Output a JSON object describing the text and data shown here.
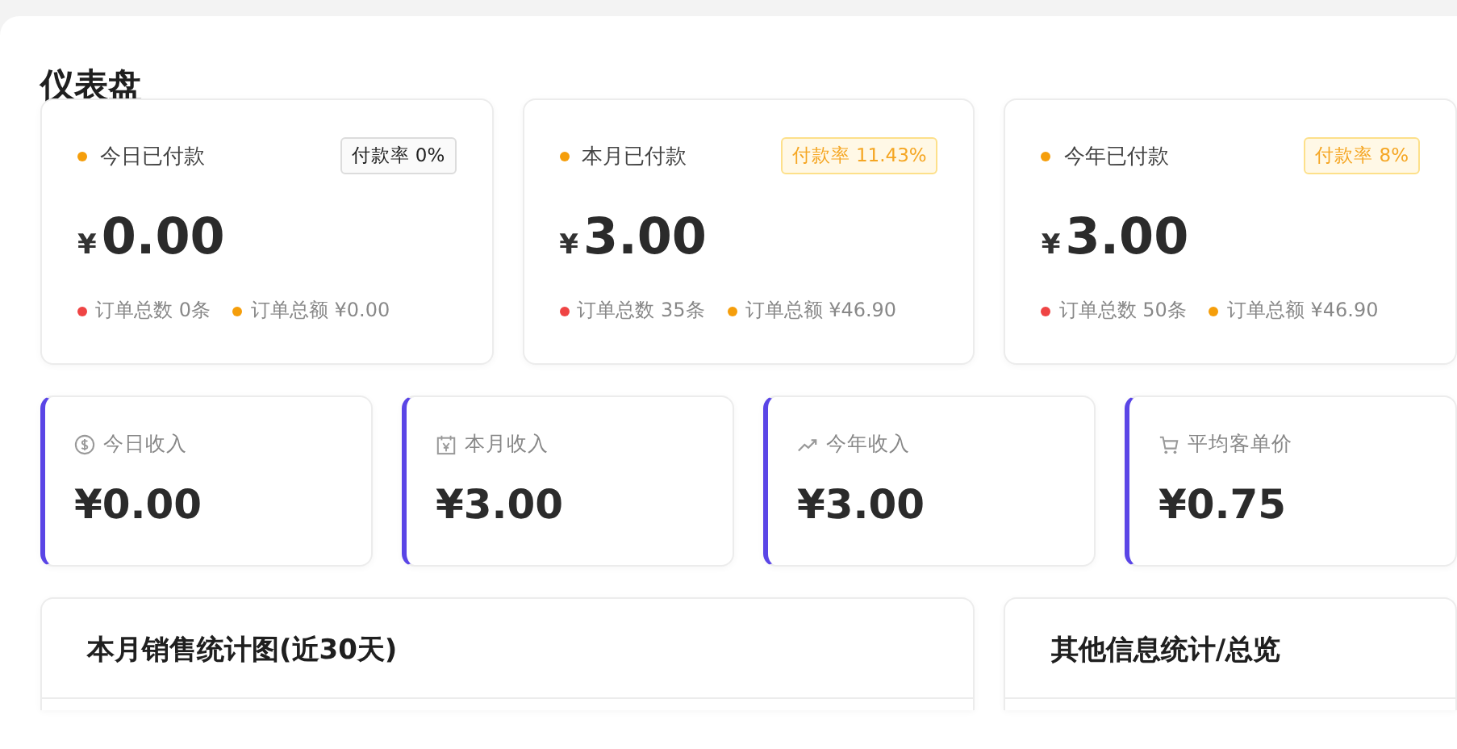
{
  "page_title": "仪表盘",
  "payment_cards": [
    {
      "title": "今日已付款",
      "badge": {
        "text": "付款率 0%",
        "kind": "neutral"
      },
      "currency": "¥",
      "amount": "0.00",
      "stats": [
        {
          "text": "订单总数 0条",
          "color": "#ef4444"
        },
        {
          "text": "订单总额 ¥0.00",
          "color": "#f59e0b"
        }
      ]
    },
    {
      "title": "本月已付款",
      "badge": {
        "text": "付款率 11.43%",
        "kind": "warning"
      },
      "currency": "¥",
      "amount": "3.00",
      "stats": [
        {
          "text": "订单总数 35条",
          "color": "#ef4444"
        },
        {
          "text": "订单总额 ¥46.90",
          "color": "#f59e0b"
        }
      ]
    },
    {
      "title": "今年已付款",
      "badge": {
        "text": "付款率 8%",
        "kind": "warning"
      },
      "currency": "¥",
      "amount": "3.00",
      "stats": [
        {
          "text": "订单总数 50条",
          "color": "#ef4444"
        },
        {
          "text": "订单总额 ¥46.90",
          "color": "#f59e0b"
        }
      ]
    }
  ],
  "income_cards": [
    {
      "kind": "dollar",
      "label": "今日收入",
      "value": "¥0.00"
    },
    {
      "kind": "calendar",
      "label": "本月收入",
      "value": "¥3.00"
    },
    {
      "kind": "trend",
      "label": "今年收入",
      "value": "¥3.00"
    },
    {
      "kind": "cart",
      "label": "平均客单价",
      "value": "¥0.75"
    }
  ],
  "panels": [
    {
      "title": "本月销售统计图(近30天)"
    },
    {
      "title": "其他信息统计/总览"
    }
  ]
}
